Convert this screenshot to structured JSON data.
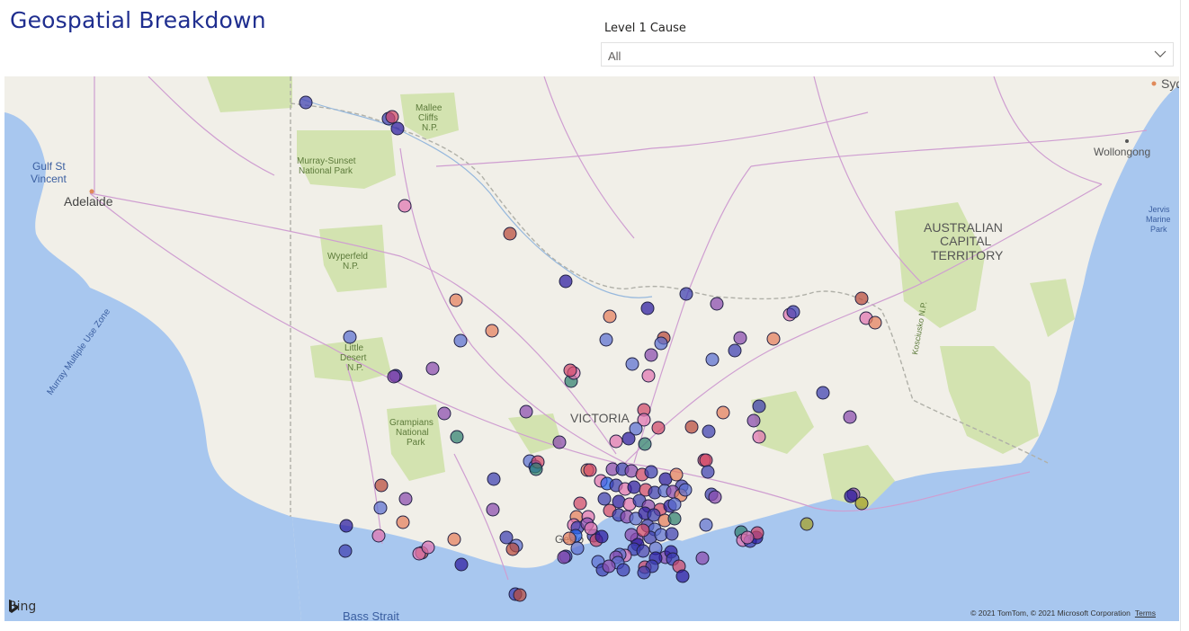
{
  "title": "Geospatial Breakdown",
  "slicer": {
    "label": "Level 1 Cause",
    "value": "All"
  },
  "map": {
    "provider": "Bing",
    "copyright": "© 2021 TomTom, © 2021 Microsoft Corporation",
    "terms_link": "Terms",
    "place_labels": [
      "Gulf St",
      "Vincent",
      "Adelaide",
      "Mallee",
      "Cliffs",
      "N.P.",
      "Murray-Sunset",
      "National Park",
      "Wyperfeld",
      "N.P.",
      "Little",
      "Desert",
      "N.P.",
      "Grampians",
      "National",
      "Park",
      "VICTORIA",
      "Wollongong",
      "AUSTRALIAN",
      "CAPITAL",
      "TERRITORY",
      "Jervis",
      "Marine",
      "Park",
      "Murray Multiple Use Zone",
      "Kosciusko N.P.",
      "Bass Strait",
      "Geelo",
      "Syd"
    ],
    "colors": {
      "water": "#a8c7ef",
      "land": "#f1efe8",
      "park": "#d3e3b0",
      "border": "#b0b0a8",
      "road": "#cf9ed1",
      "marker_palette": [
        "#3d3eb0",
        "#5b6fd0",
        "#d04868",
        "#e075b0",
        "#8a4bad",
        "#e57e5c",
        "#2f7f6e",
        "#2b1aa0",
        "#b84a3a",
        "#7c64c7",
        "#2563eb",
        "#a5a022"
      ]
    },
    "markers_note_colors": "marker colors encode cause categories"
  }
}
